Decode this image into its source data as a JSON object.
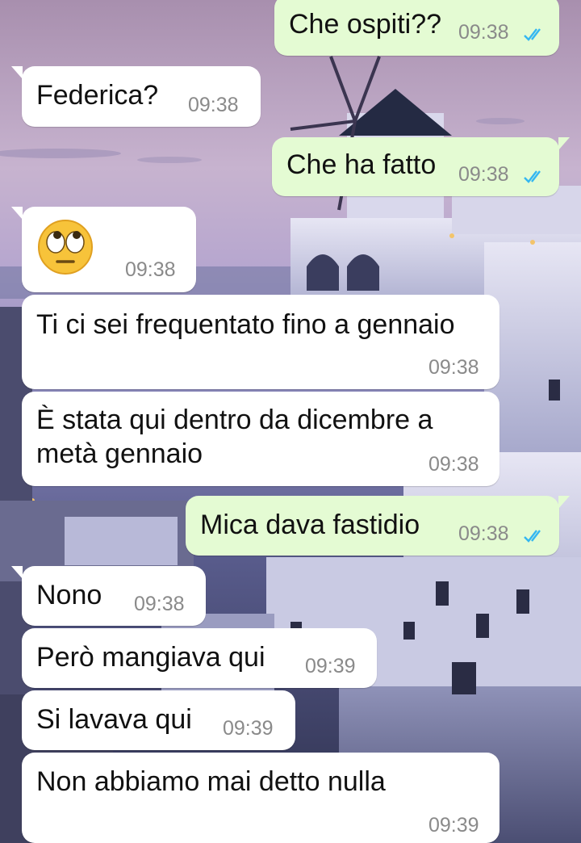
{
  "colors": {
    "incoming_bubble": "#ffffff",
    "outgoing_bubble": "#e4fbd3",
    "read_ticks": "#34b7f1",
    "timestamp": "#8a8a8a"
  },
  "messages": [
    {
      "direction": "outgoing",
      "text": "Che ospiti??",
      "time": "09:38",
      "status": "read"
    },
    {
      "direction": "incoming",
      "text": "Federica?",
      "time": "09:38"
    },
    {
      "direction": "outgoing",
      "text": "Che ha fatto",
      "time": "09:38",
      "status": "read"
    },
    {
      "direction": "incoming",
      "emoji": "face-with-rolling-eyes-emoji",
      "time": "09:38"
    },
    {
      "direction": "incoming",
      "text": "Ti ci sei frequentato fino a gennaio",
      "time": "09:38"
    },
    {
      "direction": "incoming",
      "text_lines": [
        "È stata qui dentro da dicembre a",
        "metà gennaio"
      ],
      "time": "09:38"
    },
    {
      "direction": "outgoing",
      "text": "Mica dava fastidio",
      "time": "09:38",
      "status": "read"
    },
    {
      "direction": "incoming",
      "text": "Nono",
      "time": "09:38"
    },
    {
      "direction": "incoming",
      "text": "Però mangiava qui",
      "time": "09:39"
    },
    {
      "direction": "incoming",
      "text": "Si lavava qui",
      "time": "09:39"
    },
    {
      "direction": "incoming",
      "text": "Non abbiamo mai detto nulla",
      "time": "09:39"
    }
  ]
}
